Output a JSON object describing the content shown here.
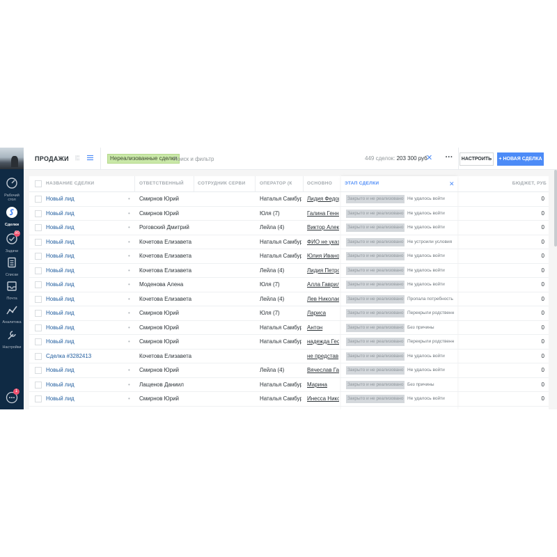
{
  "sidebar": {
    "items": [
      {
        "label": "Рабочий стол",
        "icon": "dashboard-icon",
        "badge": ""
      },
      {
        "label": "Сделки",
        "icon": "deals-icon",
        "badge": ""
      },
      {
        "label": "Задачи",
        "icon": "tasks-icon",
        "badge": "50"
      },
      {
        "label": "Списки",
        "icon": "lists-icon",
        "badge": ""
      },
      {
        "label": "Почта",
        "icon": "mail-icon",
        "badge": ""
      },
      {
        "label": "Аналитика",
        "icon": "analytics-icon",
        "badge": ""
      },
      {
        "label": "Настройки",
        "icon": "settings-icon",
        "badge": ""
      }
    ],
    "chat_badge": "1"
  },
  "header": {
    "title": "ПРОДАЖИ",
    "view_toggle": "|¦¦",
    "filter_chip": "Нереализованные сделки",
    "search_placeholder": "Поиск и фильтр",
    "summary_count": "449 сделок:",
    "summary_sum": "203 300 руб",
    "clear": "✕",
    "more": "···",
    "setup_label": "НАСТРОИТЬ",
    "new_label": "+ НОВАЯ СДЕЛКА"
  },
  "columns": {
    "name": "НАЗВАНИЕ СДЕЛКИ",
    "responsible": "ОТВЕТСТВЕННЫЙ",
    "service": "СОТРУДНИК СЕРВИ",
    "operator": "ОПЕРАТОР (К",
    "main": "ОСНОВНО",
    "stage": "ЭТАП СДЕЛКИ",
    "stage_close": "✕",
    "budget": "БЮДЖЕТ, РУБ"
  },
  "rows": [
    {
      "name": "Новый лид",
      "dot": "•",
      "responsible": "Смирнов Юрий",
      "operator": "Наталья Самбур(",
      "main": "Лидия Федор",
      "stage": "Закрыто и не реализовано",
      "reason": "Не удалось войти",
      "budget": "0"
    },
    {
      "name": "Новый лид",
      "dot": "•",
      "responsible": "Смирнов Юрий",
      "operator": "Юля (7)",
      "main": "Галина Генна",
      "stage": "Закрыто и не реализовано",
      "reason": "Не удалось войти",
      "budget": "0"
    },
    {
      "name": "Новый лид",
      "dot": "•",
      "responsible": "Роговский Дмитрий",
      "operator": "Лейла (4)",
      "main": "Виктор Алекс",
      "stage": "Закрыто и не реализовано",
      "reason": "Не удалось войти",
      "budget": "0"
    },
    {
      "name": "Новый лид",
      "dot": "•",
      "responsible": "Кочетова Елизавета",
      "operator": "Наталья Самбур(",
      "main": "ФИО не указ",
      "stage": "Закрыто и не реализовано",
      "reason": "Не устроили условия",
      "budget": "0"
    },
    {
      "name": "Новый лид",
      "dot": "•",
      "responsible": "Кочетова Елизавета",
      "operator": "Наталья Самбур(",
      "main": "Юлия Иванов",
      "stage": "Закрыто и не реализовано",
      "reason": "Не удалось войти",
      "budget": "0"
    },
    {
      "name": "Новый лид",
      "dot": "•",
      "responsible": "Кочетова Елизавета",
      "operator": "Лейла (4)",
      "main": "Лидия Петро",
      "stage": "Закрыто и не реализовано",
      "reason": "Не удалось войти",
      "budget": "0"
    },
    {
      "name": "Новый лид",
      "dot": "•",
      "responsible": "Моденова Алена",
      "operator": "Юля (7)",
      "main": "Алла Гаврилс",
      "stage": "Закрыто и не реализовано",
      "reason": "Не удалось войти",
      "budget": "0"
    },
    {
      "name": "Новый лид",
      "dot": "•",
      "responsible": "Кочетова Елизавета",
      "operator": "Лейла (4)",
      "main": "Лев Николае",
      "stage": "Закрыто и не реализовано",
      "reason": "Пропала потребность",
      "budget": "0"
    },
    {
      "name": "Новый лид",
      "dot": "•",
      "responsible": "Смирнов Юрий",
      "operator": "Юля (7)",
      "main": "Лариса",
      "stage": "Закрыто и не реализовано",
      "reason": "Перекрыли родственн",
      "budget": "0"
    },
    {
      "name": "Новый лид",
      "dot": "•",
      "responsible": "Смирнов Юрий",
      "operator": "Наталья Самбур(",
      "main": "Антон",
      "stage": "Закрыто и не реализовано",
      "reason": "Без причины",
      "budget": "0"
    },
    {
      "name": "Новый лид",
      "dot": "•",
      "responsible": "Смирнов Юрий",
      "operator": "Наталья Самбур(",
      "main": "надежда Геор",
      "stage": "Закрыто и не реализовано",
      "reason": "Перекрыли родственн",
      "budget": "0"
    },
    {
      "name": "Сделка #3282413",
      "dot": "",
      "responsible": "Кочетова Елизавета",
      "operator": "",
      "main": "не представ",
      "stage": "Закрыто и не реализовано",
      "reason": "Не удалось войти",
      "budget": "0"
    },
    {
      "name": "Новый лид",
      "dot": "•",
      "responsible": "Смирнов Юрий",
      "operator": "Лейла (4)",
      "main": "Вячеслав Гав",
      "stage": "Закрыто и не реализовано",
      "reason": "Не удалось войти",
      "budget": "0"
    },
    {
      "name": "Новый лид",
      "dot": "•",
      "responsible": "Лащенов Даниил",
      "operator": "Наталья Самбур(",
      "main": "Марина",
      "stage": "Закрыто и не реализовано",
      "reason": "Без причины",
      "budget": "0"
    },
    {
      "name": "Новый лид",
      "dot": "•",
      "responsible": "Смирнов Юрий",
      "operator": "Наталья Самбур(",
      "main": "Инесса Нико",
      "stage": "Закрыто и не реализовано",
      "reason": "Не удалось войти",
      "budget": "0"
    }
  ],
  "colors": {
    "sidebar_bg": "#0f2a44",
    "accent": "#4c8bf7",
    "filter_chip": "#c9e8a8",
    "link": "#1f5c9e",
    "badge": "#f0506e"
  }
}
